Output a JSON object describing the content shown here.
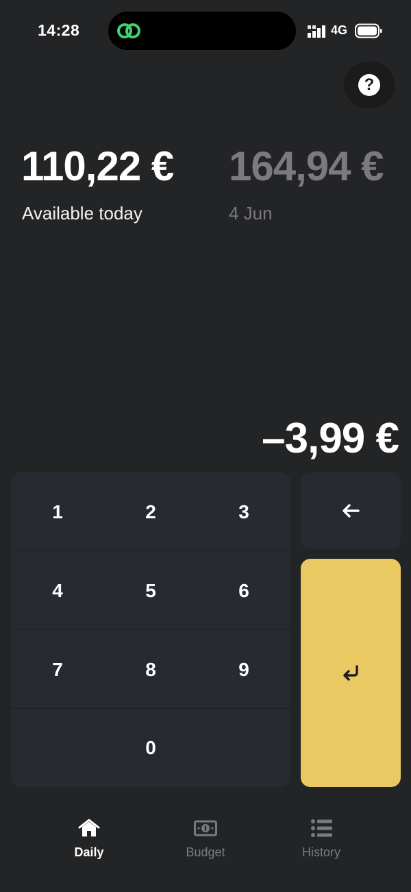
{
  "status_bar": {
    "time": "14:28",
    "network": "4G",
    "icons": [
      "link-icon",
      "signal-icon",
      "battery-icon"
    ],
    "link_color": "#3fd36b"
  },
  "help": {
    "label": "?"
  },
  "balances": [
    {
      "amount": "110,22 €",
      "caption": "Available today",
      "active": true
    },
    {
      "amount": "164,94 €",
      "caption": "4 Jun",
      "active": false
    }
  ],
  "entered_amount": "–3,99 €",
  "keypad": {
    "rows": [
      [
        "1",
        "2",
        "3"
      ],
      [
        "4",
        "5",
        "6"
      ],
      [
        "7",
        "8",
        "9"
      ],
      [
        "",
        "0",
        ""
      ]
    ],
    "backspace_icon": "arrow-left-icon",
    "enter_icon": "enter-return-icon",
    "enter_color": "#eac962"
  },
  "tabs": [
    {
      "label": "Daily",
      "icon": "home-icon",
      "active": true
    },
    {
      "label": "Budget",
      "icon": "banknote-icon",
      "active": false
    },
    {
      "label": "History",
      "icon": "list-icon",
      "active": false
    }
  ]
}
